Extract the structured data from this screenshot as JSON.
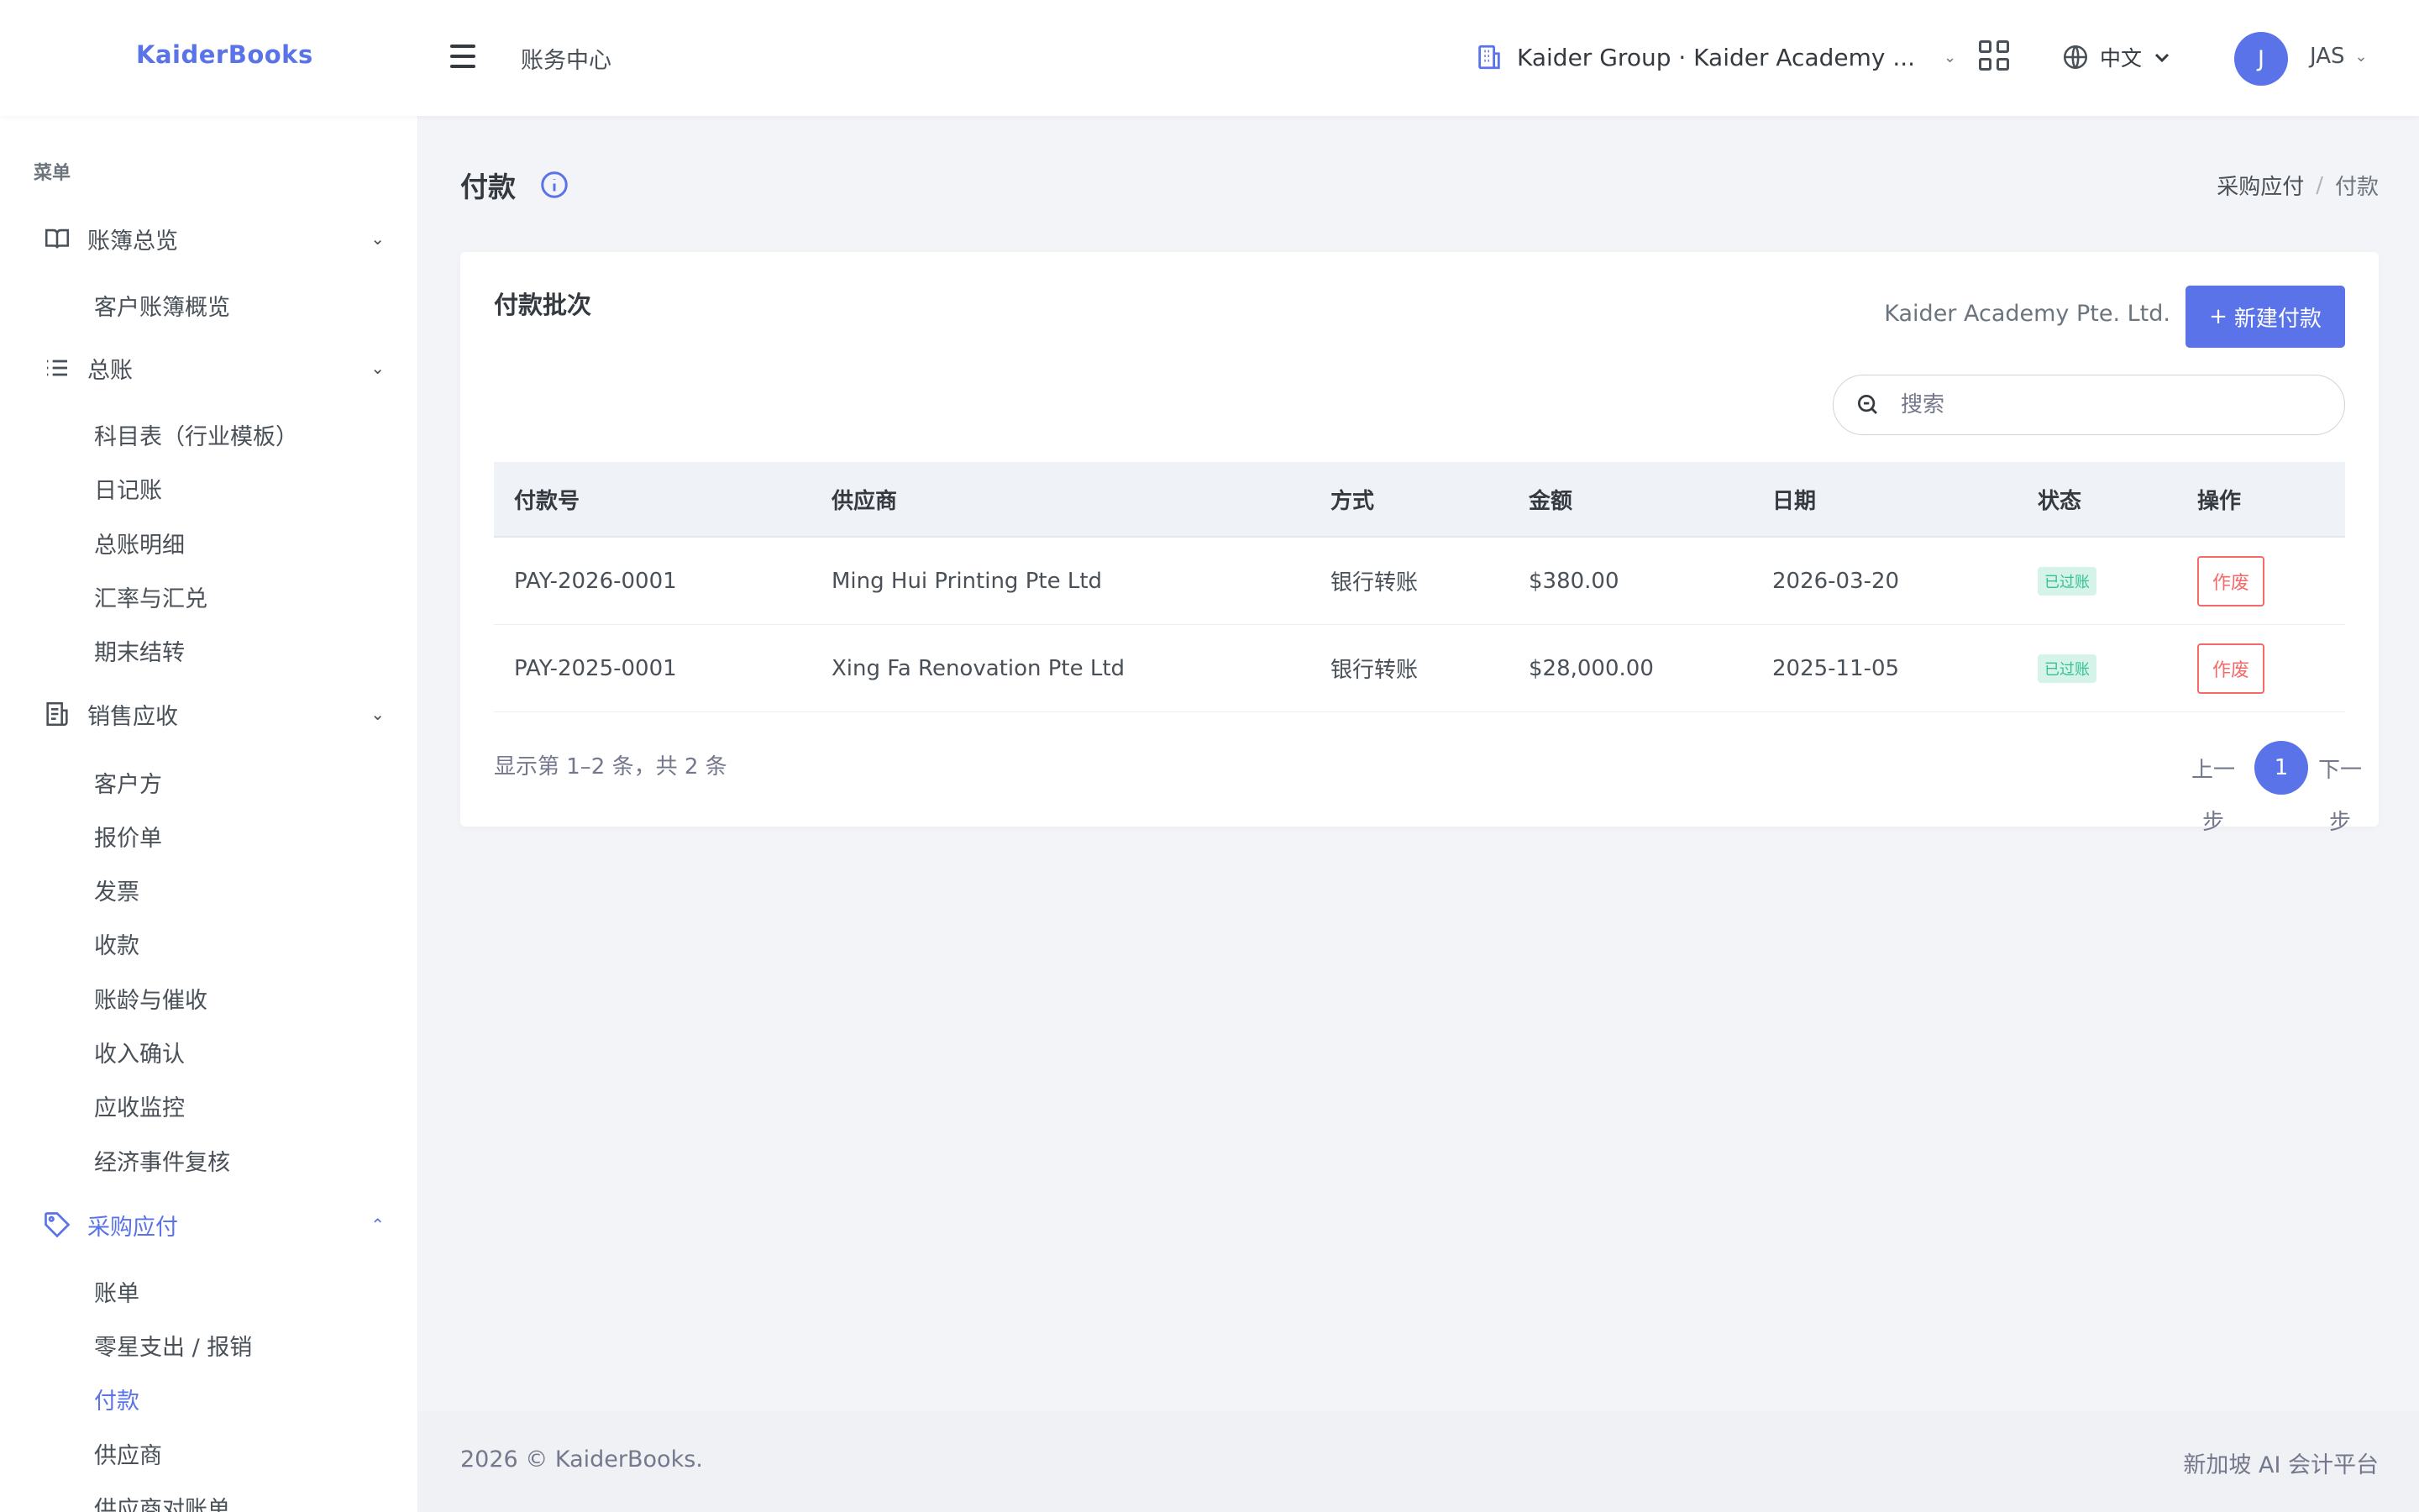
{
  "app": {
    "logo": "KaiderBooks",
    "header_page": "账务中心"
  },
  "header": {
    "org_name": "Kaider Group · Kaider Academy ...",
    "language": "中文",
    "avatar_initial": "J",
    "user_name": "JAS"
  },
  "sidebar": {
    "menu_title": "菜单",
    "groups": [
      {
        "label": "账簿总览",
        "icon": "book-open-icon",
        "items": [
          "客户账簿概览"
        ]
      },
      {
        "label": "总账",
        "icon": "list-icon",
        "items": [
          "科目表（行业模板）",
          "日记账",
          "总账明细",
          "汇率与汇兑",
          "期末结转"
        ]
      },
      {
        "label": "销售应收",
        "icon": "receipt-icon",
        "items": [
          "客户方",
          "报价单",
          "发票",
          "收款",
          "账龄与催收",
          "收入确认",
          "应收监控",
          "经济事件复核"
        ]
      },
      {
        "label": "采购应付",
        "icon": "tag-icon",
        "items": [
          "账单",
          "零星支出 / 报销",
          "付款",
          "供应商",
          "供应商对账单"
        ]
      }
    ]
  },
  "page": {
    "title": "付款",
    "breadcrumb": [
      "采购应付",
      "付款"
    ]
  },
  "card": {
    "title": "付款批次",
    "entity": "Kaider Academy Pte. Ltd.",
    "new_button": "新建付款",
    "search_placeholder": "搜索"
  },
  "table": {
    "columns": [
      "付款号",
      "供应商",
      "方式",
      "金额",
      "日期",
      "状态",
      "操作"
    ],
    "rows": [
      {
        "no": "PAY-2026-0001",
        "vendor": "Ming Hui Printing Pte Ltd",
        "method": "银行转账",
        "amount": "$380.00",
        "date": "2026-03-20",
        "status": "已过账",
        "action": "作废"
      },
      {
        "no": "PAY-2025-0001",
        "vendor": "Xing Fa Renovation Pte Ltd",
        "method": "银行转账",
        "amount": "$28,000.00",
        "date": "2025-11-05",
        "status": "已过账",
        "action": "作废"
      }
    ]
  },
  "pagination": {
    "summary": "显示第 1–2 条，共 2 条",
    "prev": "上一步",
    "current": "1",
    "next": "下一步"
  },
  "footer": {
    "left": "2026 © KaiderBooks.",
    "right": "新加坡 AI 会计平台"
  },
  "colors": {
    "primary": "#5b73e8",
    "success": "#34c38f",
    "danger": "#f46a6a"
  }
}
